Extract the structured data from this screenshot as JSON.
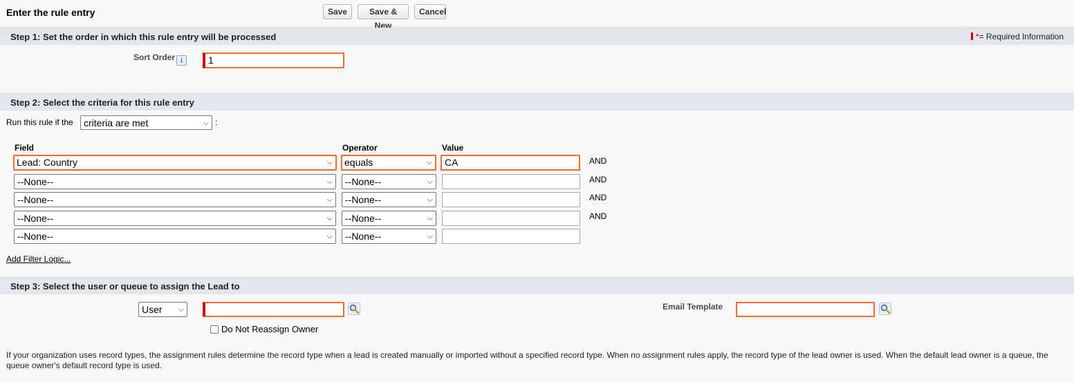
{
  "header": {
    "title": "Enter the rule entry",
    "save_label": "Save",
    "save_new_label": "Save & New",
    "cancel_label": "Cancel"
  },
  "step1": {
    "title": "Step 1: Set the order in which this rule entry will be processed",
    "required_info": "= Required Information",
    "required_star": "*",
    "sort_order_label": "Sort Order",
    "info_glyph": "i",
    "sort_order_value": "1"
  },
  "step2": {
    "title": "Step 2: Select the criteria for this rule entry",
    "run_rule_prefix": "Run this rule if the",
    "run_rule_value": "criteria are met",
    "run_rule_suffix": ":",
    "col_field": "Field",
    "col_operator": "Operator",
    "col_value": "Value",
    "rows": [
      {
        "field": "Lead: Country",
        "operator": "equals",
        "value": "CA",
        "connector": "AND"
      },
      {
        "field": "--None--",
        "operator": "--None--",
        "value": "",
        "connector": "AND"
      },
      {
        "field": "--None--",
        "operator": "--None--",
        "value": "",
        "connector": "AND"
      },
      {
        "field": "--None--",
        "operator": "--None--",
        "value": "",
        "connector": "AND"
      },
      {
        "field": "--None--",
        "operator": "--None--",
        "value": "",
        "connector": ""
      }
    ],
    "add_filter_logic": "Add Filter Logic..."
  },
  "step3": {
    "title": "Step 3: Select the user or queue to assign the Lead to",
    "assignee_type": "User",
    "assignee_value": "",
    "do_not_reassign_label": "Do Not Reassign Owner",
    "email_template_label": "Email Template",
    "email_template_value": ""
  },
  "footnote": "If your organization uses record types, the assignment rules determine the record type when a lead is created manually or imported without a specified record type. When no assignment rules apply, the record type of the lead owner is used. When the default lead owner is a queue, the queue owner's default record type is used.",
  "colors": {
    "highlight": "#f26a2c",
    "required": "#cc0000",
    "section_bg": "#e3e6ec"
  },
  "icons": {
    "lookup": "magnifier-lookup-icon",
    "info": "info-icon",
    "dropdown": "chevron-down-icon"
  }
}
